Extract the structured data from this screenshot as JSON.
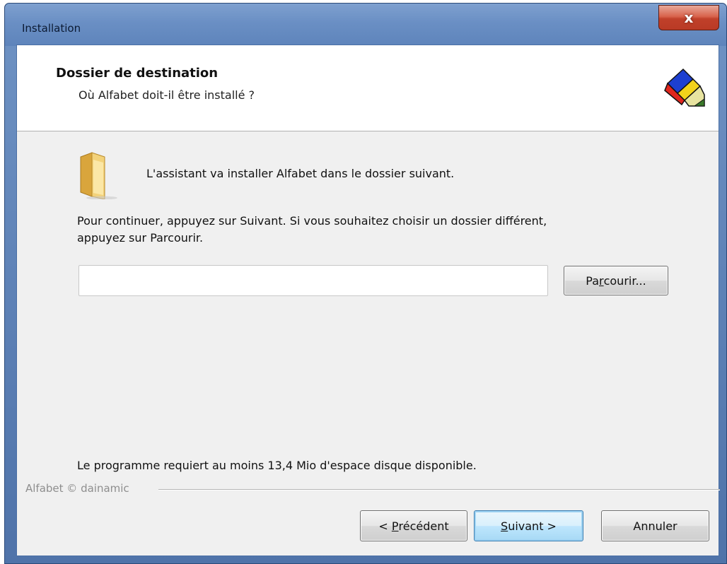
{
  "window": {
    "title": "Installation",
    "close_glyph": "x"
  },
  "header": {
    "title": "Dossier de destination",
    "subtitle": "Où Alfabet doit-il être installé ?",
    "logo_icon": "app-logo-icon"
  },
  "body": {
    "folder_icon": "folder-icon",
    "intro": "L'assistant va installer Alfabet dans le dossier suivant.",
    "continue_line1": "Pour continuer, appuyez sur Suivant. Si vous souhaitez choisir un dossier différent,",
    "continue_line2": "appuyez sur Parcourir.",
    "path_value": "",
    "browse_button": {
      "pre": "Pa",
      "accel": "r",
      "post": "courir..."
    },
    "disk_space": "Le programme requiert au moins 13,4 Mio d'espace disque disponible."
  },
  "footer": {
    "brand": "Alfabet © dainamic",
    "prev_button": {
      "pre": "< ",
      "accel": "P",
      "post": "récédent"
    },
    "next_button": {
      "pre": "",
      "accel": "S",
      "post": "uivant >"
    },
    "cancel_button": "Annuler"
  },
  "colors": {
    "title_bar": "#6a8fc4",
    "close_button": "#c0402a",
    "client_bg": "#f0f0f0",
    "default_button_border": "#3c7fb1"
  }
}
